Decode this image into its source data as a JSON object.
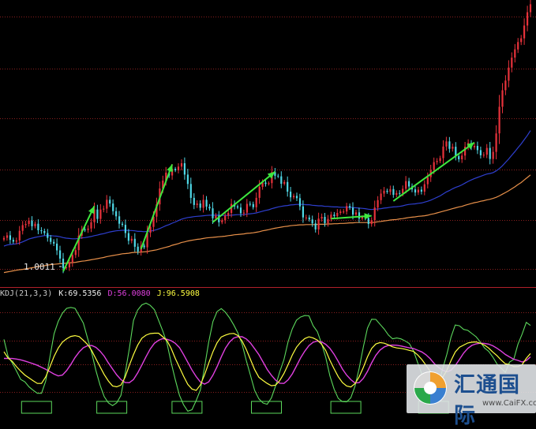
{
  "chart_data": [
    {
      "type": "candlestick",
      "panel": "price",
      "colors": {
        "up": "#e8323b",
        "down": "#4fd8e6",
        "ma_fast": "#2e3fcf",
        "ma_slow": "#e8904a",
        "arrow": "#3ee83e",
        "grid": "#8a1f1f"
      },
      "low_label": "1.0011",
      "ylim": [
        0.9975,
        1.0975
      ],
      "close": [
        1.0137,
        1.0146,
        1.013,
        1.0124,
        1.0128,
        1.0162,
        1.0182,
        1.0186,
        1.0198,
        1.0178,
        1.0187,
        1.0164,
        1.0161,
        1.0154,
        1.0137,
        1.0123,
        1.0117,
        1.0093,
        1.0064,
        1.0031,
        1.0033,
        1.0052,
        1.0077,
        1.0094,
        1.0145,
        1.0167,
        1.0165,
        1.017,
        1.0192,
        1.0237,
        1.0204,
        1.0237,
        1.024,
        1.0271,
        1.0258,
        1.0231,
        1.0213,
        1.0187,
        1.0183,
        1.0154,
        1.0127,
        1.0134,
        1.0106,
        1.0089,
        1.011,
        1.0104,
        1.0155,
        1.0176,
        1.0212,
        1.0255,
        1.0311,
        1.0339,
        1.0367,
        1.0357,
        1.038,
        1.0375,
        1.0388,
        1.04,
        1.036,
        1.0327,
        1.0278,
        1.0253,
        1.0258,
        1.0243,
        1.0271,
        1.0247,
        1.0241,
        1.0206,
        1.0215,
        1.0192,
        1.0199,
        1.0215,
        1.0225,
        1.0257,
        1.0248,
        1.0244,
        1.0224,
        1.0226,
        1.0257,
        1.0256,
        1.0245,
        1.0278,
        1.0317,
        1.0332,
        1.0327,
        1.033,
        1.0369,
        1.0356,
        1.0354,
        1.0328,
        1.0334,
        1.03,
        1.028,
        1.0285,
        1.0277,
        1.0248,
        1.0209,
        1.0209,
        1.0202,
        1.0188,
        1.0167,
        1.0205,
        1.0211,
        1.0189,
        1.0204,
        1.0219,
        1.0214,
        1.0225,
        1.023,
        1.023,
        1.0249,
        1.0244,
        1.0219,
        1.0227,
        1.0205,
        1.021,
        1.0207,
        1.0186,
        1.0199,
        1.0244,
        1.027,
        1.0293,
        1.0303,
        1.0299,
        1.0309,
        1.0289,
        1.0295,
        1.0294,
        1.031,
        1.0337,
        1.0318,
        1.0308,
        1.0297,
        1.0307,
        1.03,
        1.0326,
        1.0351,
        1.0376,
        1.0404,
        1.0408,
        1.0418,
        1.0459,
        1.0477,
        1.0451,
        1.0458,
        1.0425,
        1.0414,
        1.0427,
        1.0458,
        1.0471,
        1.0456,
        1.0461,
        1.0446,
        1.0428,
        1.043,
        1.0454,
        1.0415,
        1.044,
        1.0505,
        1.0599,
        1.0657,
        1.0691,
        1.0737,
        1.0772,
        1.0801,
        1.0827,
        1.084,
        1.0885,
        1.0932,
        1.096
      ],
      "ma_fast": [
        1.0108,
        1.0112,
        1.0114,
        1.0115,
        1.0116,
        1.0119,
        1.0123,
        1.0128,
        1.0133,
        1.0136,
        1.0139,
        1.0141,
        1.0143,
        1.0145,
        1.0145,
        1.0145,
        1.0144,
        1.0143,
        1.0141,
        1.0138,
        1.0136,
        1.0135,
        1.0134,
        1.0134,
        1.0135,
        1.0137,
        1.0138,
        1.014,
        1.0142,
        1.0145,
        1.0147,
        1.015,
        1.0152,
        1.0155,
        1.0158,
        1.016,
        1.0162,
        1.0163,
        1.0164,
        1.0164,
        1.0163,
        1.0163,
        1.0162,
        1.016,
        1.016,
        1.0159,
        1.016,
        1.0161,
        1.0163,
        1.0166,
        1.017,
        1.0175,
        1.018,
        1.0184,
        1.0189,
        1.0193,
        1.0198,
        1.0203,
        1.0206,
        1.0209,
        1.021,
        1.0212,
        1.0213,
        1.0214,
        1.0215,
        1.0216,
        1.0217,
        1.0217,
        1.0217,
        1.0217,
        1.0216,
        1.0216,
        1.0216,
        1.0217,
        1.0218,
        1.0219,
        1.0219,
        1.0219,
        1.0221,
        1.0222,
        1.0223,
        1.0225,
        1.0228,
        1.0231,
        1.0234,
        1.0236,
        1.024,
        1.0243,
        1.0246,
        1.0248,
        1.025,
        1.0251,
        1.0253,
        1.0254,
        1.0255,
        1.0255,
        1.0255,
        1.0254,
        1.0254,
        1.0252,
        1.0251,
        1.025,
        1.025,
        1.0248,
        1.0248,
        1.0247,
        1.0246,
        1.0246,
        1.0245,
        1.0245,
        1.0245,
        1.0245,
        1.0244,
        1.0243,
        1.0242,
        1.0241,
        1.024,
        1.0238,
        1.0237,
        1.0238,
        1.0239,
        1.024,
        1.0242,
        1.0243,
        1.0245,
        1.0246,
        1.0247,
        1.0248,
        1.025,
        1.0253,
        1.0255,
        1.0256,
        1.0257,
        1.0259,
        1.026,
        1.0263,
        1.0266,
        1.027,
        1.0275,
        1.028,
        1.0285,
        1.0292,
        1.0299,
        1.0304,
        1.031,
        1.0315,
        1.0319,
        1.0324,
        1.033,
        1.0336,
        1.0341,
        1.0346,
        1.035,
        1.0354,
        1.0358,
        1.0362,
        1.0364,
        1.0367,
        1.0373,
        1.0381,
        1.0391,
        1.0403,
        1.0415,
        1.0428,
        1.0441,
        1.0455,
        1.0468,
        1.0483,
        1.0498,
        1.0515
      ],
      "ma_slow": [
        1.0015,
        1.0017,
        1.0019,
        1.0021,
        1.0023,
        1.0025,
        1.0026,
        1.0028,
        1.003,
        1.0032,
        1.0034,
        1.0036,
        1.0038,
        1.0039,
        1.0041,
        1.0043,
        1.0044,
        1.0045,
        1.0046,
        1.0047,
        1.0048,
        1.0049,
        1.005,
        1.0051,
        1.0053,
        1.0055,
        1.0056,
        1.0058,
        1.006,
        1.0062,
        1.0064,
        1.0066,
        1.0068,
        1.0071,
        1.0073,
        1.0075,
        1.0077,
        1.0079,
        1.0081,
        1.0082,
        1.0083,
        1.0085,
        1.0086,
        1.0086,
        1.0087,
        1.0088,
        1.0089,
        1.0091,
        1.0093,
        1.0095,
        1.0098,
        1.0101,
        1.0104,
        1.0107,
        1.0111,
        1.0114,
        1.0117,
        1.0121,
        1.0123,
        1.0126,
        1.0128,
        1.013,
        1.0132,
        1.0133,
        1.0135,
        1.0137,
        1.0138,
        1.0139,
        1.014,
        1.0141,
        1.0142,
        1.0143,
        1.0145,
        1.0146,
        1.0148,
        1.0149,
        1.015,
        1.0151,
        1.0153,
        1.0154,
        1.0155,
        1.0157,
        1.0159,
        1.0162,
        1.0164,
        1.0166,
        1.0169,
        1.0171,
        1.0173,
        1.0175,
        1.0177,
        1.0178,
        1.018,
        1.0181,
        1.0182,
        1.0183,
        1.0183,
        1.0184,
        1.0184,
        1.0184,
        1.0184,
        1.0185,
        1.0185,
        1.0185,
        1.0186,
        1.0186,
        1.0187,
        1.0187,
        1.0188,
        1.0188,
        1.0189,
        1.019,
        1.019,
        1.0191,
        1.0191,
        1.0191,
        1.0191,
        1.0191,
        1.0191,
        1.0192,
        1.0194,
        1.0195,
        1.0197,
        1.0198,
        1.02,
        1.0201,
        1.0202,
        1.0204,
        1.0205,
        1.0207,
        1.0209,
        1.021,
        1.0211,
        1.0213,
        1.0214,
        1.0215,
        1.0217,
        1.022,
        1.0222,
        1.0225,
        1.0228,
        1.0231,
        1.0234,
        1.0237,
        1.024,
        1.0243,
        1.0246,
        1.0248,
        1.0252,
        1.0255,
        1.0258,
        1.0261,
        1.0263,
        1.0266,
        1.0268,
        1.0271,
        1.0273,
        1.0276,
        1.028,
        1.0285,
        1.0291,
        1.0297,
        1.0303,
        1.031,
        1.0317,
        1.0325,
        1.0332,
        1.0341,
        1.035,
        1.0359
      ]
    },
    {
      "type": "line",
      "panel": "indicator",
      "indicator": "KDJ",
      "params": "(21,3,3)",
      "ylim": [
        -20,
        130
      ],
      "colors": {
        "K": "#f0f0f0",
        "D": "#e040e0",
        "J": "#ffff40",
        "J_line": "#5cd85c",
        "box": "#5cd85c"
      },
      "legend": {
        "name": "KDJ(21,3,3)",
        "k_label": "K:69.5356",
        "d_label": "D:56.0080",
        "j_label": "J:96.5908"
      },
      "K": [
        62.6,
        54.4,
        50.1,
        43.3,
        37.6,
        32.5,
        28.7,
        25.0,
        21.6,
        21.6,
        30.0,
        43.0,
        56.6,
        67.4,
        75.1,
        79.4,
        82.5,
        83.5,
        82.2,
        77.3,
        72.0,
        64.1,
        53.5,
        43.2,
        33.2,
        24.8,
        18.4,
        17.2,
        19.5,
        29.7,
        45.0,
        59.0,
        71.1,
        80.1,
        84.1,
        86.1,
        86.6,
        86.6,
        82.0,
        77.0,
        67.2,
        54.1,
        42.4,
        30.9,
        20.4,
        14.4,
        12.6,
        19.6,
        32.8,
        48.0,
        62.4,
        74.3,
        81.7,
        84.2,
        85.9,
        86.3,
        83.6,
        76.5,
        65.5,
        52.5,
        39.5,
        29.7,
        25.4,
        21.6,
        18.7,
        19.4,
        25.3,
        34.5,
        46.0,
        58.5,
        68.5,
        74.9,
        79.7,
        81.9,
        80.4,
        77.8,
        72.4,
        64.3,
        51.5,
        40.6,
        30.3,
        22.8,
        18.3,
        17.0,
        21.3,
        30.2,
        42.3,
        56.0,
        66.9,
        72.7,
        74.5,
        73.7,
        71.5,
        69.0,
        67.6,
        66.9,
        65.9,
        64.4,
        63.1,
        58.5,
        52.6,
        45.1,
        37.1,
        28.8,
        25.7,
        29.6,
        38.8,
        51.3,
        62.2,
        68.4,
        71.2,
        74.0,
        75.0,
        75.3,
        73.6,
        71.2,
        67.3,
        62.0,
        57.5,
        51.8,
        47.0,
        46.1,
        43.4,
        43.5,
        45.8,
        54.1,
        60.3
      ],
      "D": [
        54.0,
        54.1,
        53.9,
        53.2,
        52.1,
        50.6,
        48.9,
        47.0,
        45.1,
        42.5,
        39.9,
        36.8,
        33.7,
        31.3,
        32.5,
        38.3,
        46.1,
        55.1,
        62.3,
        67.8,
        70.4,
        70.7,
        68.3,
        63.4,
        56.9,
        48.2,
        40.3,
        32.7,
        26.6,
        22.8,
        22.6,
        26.6,
        35.2,
        45.5,
        56.2,
        66.1,
        73.6,
        77.4,
        79.6,
        78.8,
        76.9,
        73.6,
        68.1,
        58.9,
        49.0,
        39.0,
        30.5,
        23.6,
        20.7,
        23.7,
        32.2,
        43.4,
        55.9,
        67.2,
        75.3,
        80.4,
        82.1,
        82.0,
        79.2,
        73.9,
        66.5,
        59.0,
        49.4,
        39.7,
        32.2,
        25.9,
        21.9,
        21.6,
        26.2,
        34.0,
        44.3,
        54.7,
        63.4,
        70.6,
        74.9,
        76.4,
        75.4,
        72.2,
        67.0,
        59.4,
        50.1,
        40.2,
        32.4,
        26.5,
        22.2,
        22.7,
        28.3,
        37.1,
        48.3,
        58.1,
        64.8,
        68.8,
        70.8,
        71.2,
        71.0,
        70.1,
        68.9,
        67.7,
        66.8,
        64.6,
        62.3,
        58.7,
        53.6,
        47.2,
        42.5,
        38.8,
        36.6,
        38.8,
        44.6,
        52.6,
        60.8,
        66.9,
        70.9,
        72.9,
        73.7,
        73.5,
        72.5,
        70.3,
        67.0,
        63.4,
        59.1,
        55.9,
        53.0,
        51.4,
        49.4,
        51.2,
        56.0
      ],
      "J": [
        78.6,
        56.4,
        48.1,
        37.7,
        26.8,
        23.7,
        17.1,
        12.8,
        8.9,
        8.9,
        24.6,
        55.5,
        85.8,
        101.9,
        112.6,
        118.8,
        120.0,
        118.8,
        109.3,
        99.7,
        80.2,
        61.2,
        38.4,
        19.4,
        4.6,
        -3.5,
        -7.0,
        -3.4,
        6.1,
        34.4,
        66.4,
        103.1,
        116.6,
        123.3,
        125.5,
        122.7,
        117.0,
        103.3,
        89.5,
        73.8,
        49.2,
        26.7,
        6.3,
        -6.0,
        -14.3,
        -12.3,
        -0.6,
        13.1,
        42.2,
        75.3,
        101.5,
        114.6,
        118.5,
        113.7,
        106.3,
        97.1,
        86.9,
        72.5,
        51.3,
        32.0,
        12.6,
        1.7,
        -3.7,
        -5.3,
        2.9,
        18.5,
        36.8,
        52.4,
        75.8,
        92.2,
        103.5,
        107.6,
        109.5,
        109.1,
        96.2,
        88.7,
        73.4,
        55.5,
        31.4,
        14.4,
        2.2,
        -1.9,
        -2.2,
        3.1,
        18.1,
        41.2,
        69.0,
        93.3,
        104.7,
        104.5,
        98.2,
        92.0,
        84.3,
        79.4,
        80.4,
        79.3,
        76.6,
        73.3,
        63.8,
        48.6,
        33.7,
        21.8,
        8.3,
        6.3,
        19.3,
        40.9,
        59.5,
        81.7,
        97.2,
        96.2,
        91.5,
        90.3,
        86.1,
        81.9,
        75.2,
        67.6,
        63.1,
        55.6,
        46.6,
        41.2,
        35.9,
        49.3,
        52.7,
        72.2,
        85.4,
        100.6,
        96.6
      ]
    }
  ],
  "watermark": {
    "title": "汇通国际",
    "title_prefix": "通",
    "url": "www.CaiFX.com"
  }
}
